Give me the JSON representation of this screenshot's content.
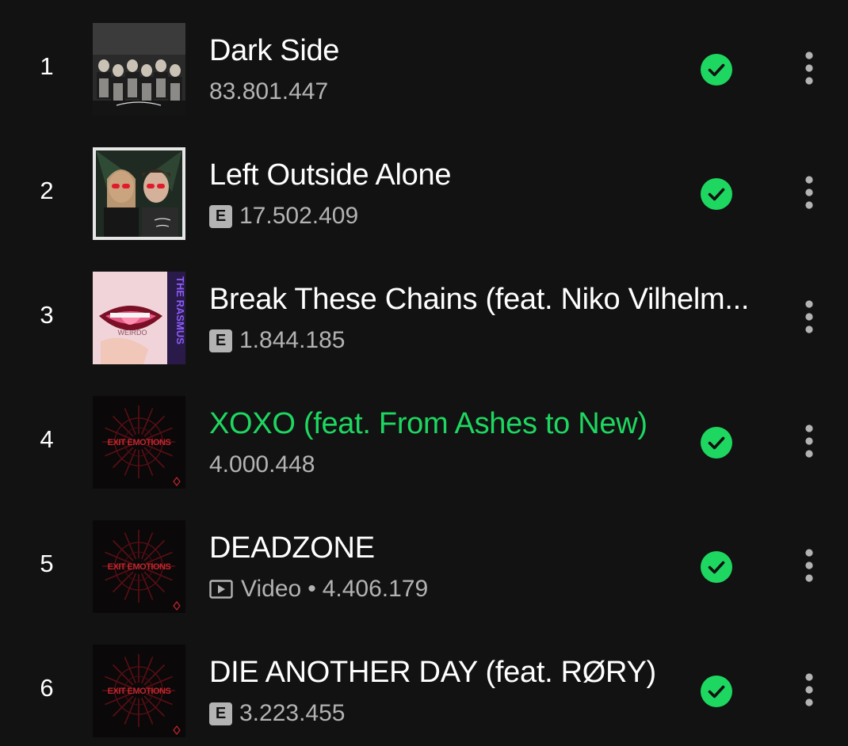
{
  "tracks": [
    {
      "index": "1",
      "title": "Dark Side",
      "explicit": false,
      "video": false,
      "video_label": "",
      "plays": "83.801.447",
      "saved": true,
      "playing": false,
      "cover": "dark-side-cover"
    },
    {
      "index": "2",
      "title": "Left Outside Alone",
      "explicit": true,
      "video": false,
      "video_label": "",
      "plays": "17.502.409",
      "saved": true,
      "playing": false,
      "cover": "left-outside-alone-cover"
    },
    {
      "index": "3",
      "title": "Break These Chains (feat. Niko Vilhelm...",
      "explicit": true,
      "video": false,
      "video_label": "",
      "plays": "1.844.185",
      "saved": false,
      "playing": false,
      "cover": "the-rasmus-weirdo-cover"
    },
    {
      "index": "4",
      "title": "XOXO (feat. From Ashes to New)",
      "explicit": false,
      "video": false,
      "video_label": "",
      "plays": "4.000.448",
      "saved": true,
      "playing": true,
      "cover": "exit-emotions-cover"
    },
    {
      "index": "5",
      "title": "DEADZONE",
      "explicit": false,
      "video": true,
      "video_label": "Video",
      "plays": "4.406.179",
      "saved": true,
      "playing": false,
      "cover": "exit-emotions-cover"
    },
    {
      "index": "6",
      "title": "DIE ANOTHER DAY (feat. RØRY)",
      "explicit": true,
      "video": false,
      "video_label": "",
      "plays": "3.223.455",
      "saved": true,
      "playing": false,
      "cover": "exit-emotions-cover"
    }
  ],
  "labels": {
    "explicit_badge": "E",
    "separator": "•",
    "cover_text_exit_emotions": "EXIT EMOTIONS",
    "cover_text_the_rasmus": "THE RASMUS",
    "cover_text_weirdo": "WEIRDO"
  },
  "icons": {
    "saved": "check-circle-icon",
    "more": "more-vertical-icon",
    "video": "video-play-icon"
  },
  "colors": {
    "background": "#121212",
    "text_primary": "#ffffff",
    "text_secondary": "#b3b3b3",
    "accent": "#1ed760"
  }
}
